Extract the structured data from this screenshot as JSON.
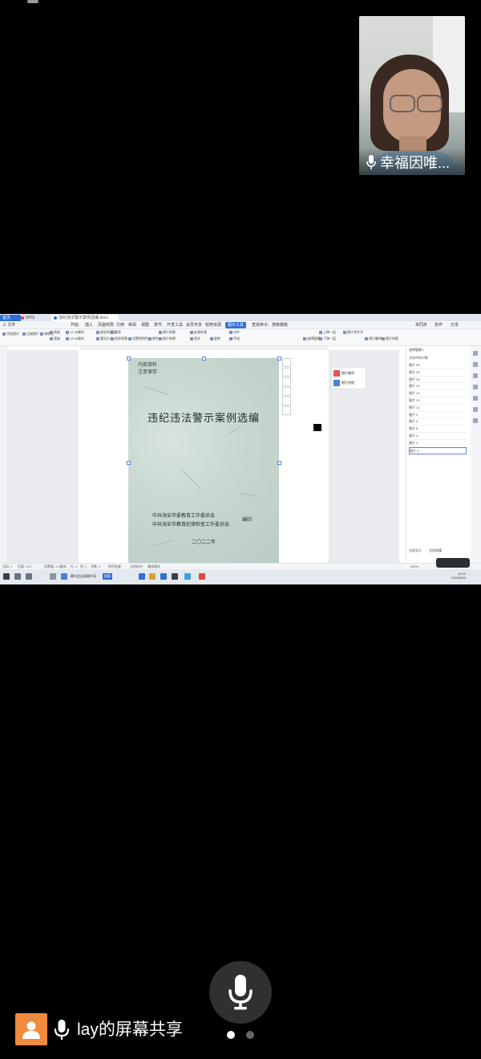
{
  "video": {
    "participant_name": "幸福因唯...",
    "mic_icon": "microphone-icon"
  },
  "wps": {
    "tabs": [
      {
        "label": "首页"
      },
      {
        "label": "WPS"
      },
      {
        "label": "违纪违法警示案例选编.docx"
      }
    ],
    "menu": [
      "三 文件",
      "开始",
      "插入",
      "页面布局",
      "引用",
      "审阅",
      "视图",
      "章节",
      "开发工具",
      "会员专享",
      "稻壳资源",
      "图片工具",
      "查找命令、搜索模板"
    ],
    "menu_right": [
      "未同步",
      "协作",
      "分享"
    ],
    "ribbon": [
      "添加图片",
      "压缩图片",
      "清晰化",
      "高度",
      "宽度",
      "17.98厘米",
      "13.50厘米",
      "锁定纵横比",
      "重设大小",
      "裁剪",
      "抠除背景",
      "设置透明色",
      "颜色",
      "图片轮廓",
      "图片效果",
      "批量处理",
      "组合",
      "旋转",
      "对齐",
      "环绕",
      "上移一层",
      "下移一层",
      "选择窗格",
      "图片转文字",
      "图片翻译",
      "图片拼图"
    ],
    "cover": {
      "tag1": "内部资料",
      "tag2": "注意保存",
      "title": "违纪违法警示案例选编",
      "org1": "中共海安市委教育工作委员会",
      "org2": "中共海安市教育纪律检查工作委员会",
      "edit": "编印",
      "year": "二〇二二年"
    },
    "float_panel": {
      "btn1": "图片翻译",
      "btn2": "图片拼图"
    },
    "right_panel": {
      "title": "选择窗格 ×",
      "subtitle": "文档中的对象",
      "items": [
        "图片 26",
        "图片 25",
        "图片 24",
        "图片 23",
        "图片 12",
        "图片 13",
        "图片 11",
        "图片 9",
        "图片 4",
        "图片 8",
        "图片 3",
        "图片 2",
        "图片 1"
      ],
      "footer_show": "全部显示",
      "footer_hide": "全部隐藏"
    },
    "statusbar": [
      "页码: 1",
      "页面: 1/27",
      "设置值: 2.5厘米",
      "行: 1",
      "列: 1",
      "字数: 0",
      "拼写检查",
      "文档校对",
      "兼容模式"
    ],
    "zoom": "100%",
    "taskbar": {
      "app_label": "腾讯会议屏幕共享",
      "search_label": "搜索",
      "time": "11:02",
      "date": "2022/6/24"
    }
  },
  "bottom": {
    "share_label": "lay的屏幕共享",
    "page_dots": 2,
    "active_dot": 0
  },
  "colors": {
    "background": "#000000",
    "wps_blue": "#2f6fd6",
    "avatar_orange": "#f08a3c"
  }
}
